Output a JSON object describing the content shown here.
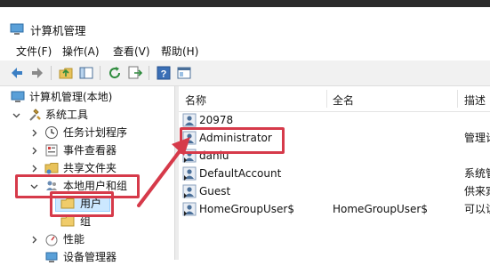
{
  "window": {
    "title": "计算机管理"
  },
  "menu": [
    {
      "label": "文件(F)"
    },
    {
      "label": "操作(A)"
    },
    {
      "label": "查看(V)"
    },
    {
      "label": "帮助(H)"
    }
  ],
  "toolbar": {
    "buttons": [
      "back-arrow-icon",
      "forward-arrow-icon",
      "up-folder-icon",
      "show-hide-tree-icon",
      "refresh-icon",
      "export-list-icon",
      "help-icon",
      "properties-icon"
    ]
  },
  "tree": {
    "root": "计算机管理(本地)",
    "system_tools": "系统工具",
    "task_scheduler": "任务计划程序",
    "event_viewer": "事件查看器",
    "shared_folders": "共享文件夹",
    "local_users_groups": "本地用户和组",
    "users": "用户",
    "groups": "组",
    "performance": "性能",
    "device_manager": "设备管理器"
  },
  "list": {
    "columns": [
      "名称",
      "全名",
      "描述"
    ],
    "rows": [
      {
        "name": "20978",
        "fullname": "",
        "desc": ""
      },
      {
        "name": "Administrator",
        "fullname": "",
        "desc": "管理计"
      },
      {
        "name": "daniu",
        "fullname": "",
        "desc": ""
      },
      {
        "name": "DefaultAccount",
        "fullname": "",
        "desc": "系统管"
      },
      {
        "name": "Guest",
        "fullname": "",
        "desc": "供来宾"
      },
      {
        "name": "HomeGroupUser$",
        "fullname": "HomeGroupUser$",
        "desc": "可以访"
      }
    ]
  },
  "colors": {
    "annotation": "#d63a4a",
    "selection": "#cce8ff"
  }
}
